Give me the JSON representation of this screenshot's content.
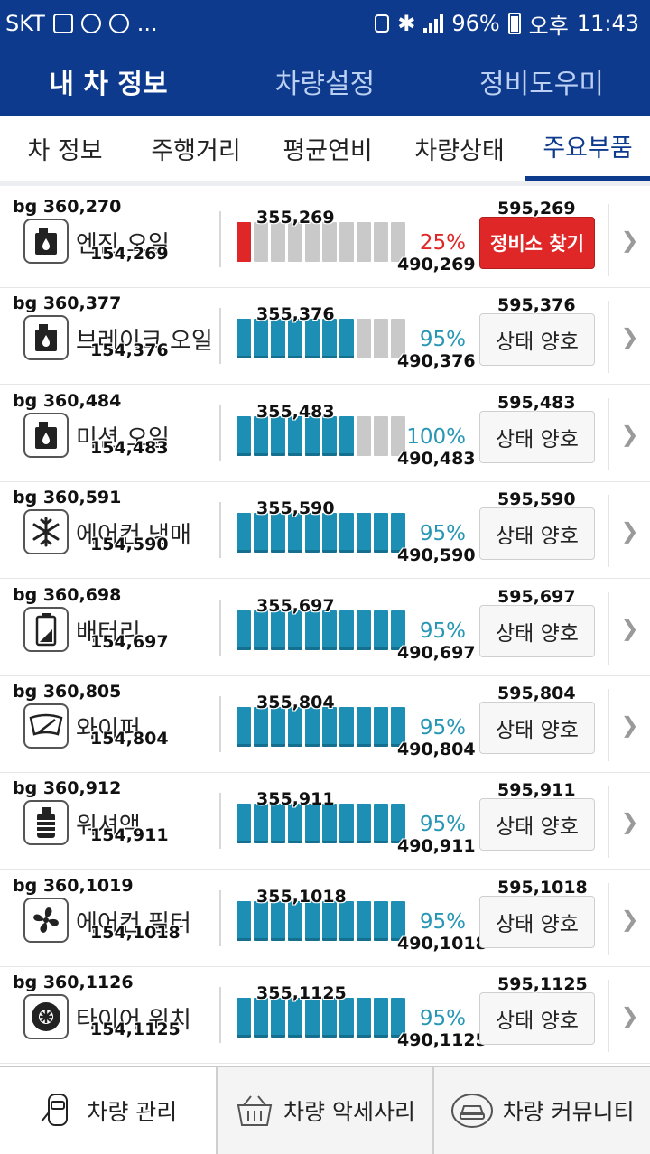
{
  "status_bar": {
    "carrier": "SKT",
    "more": "...",
    "battery": "96%",
    "ampm": "오후",
    "time": "11:43"
  },
  "app_tabs": [
    {
      "label": "내 차 정보",
      "active": true
    },
    {
      "label": "차량설정",
      "active": false
    },
    {
      "label": "정비도우미",
      "active": false
    }
  ],
  "sub_tabs": [
    {
      "label": "차 정보",
      "active": false
    },
    {
      "label": "주행거리",
      "active": false
    },
    {
      "label": "평균연비",
      "active": false
    },
    {
      "label": "차량상태",
      "active": false
    },
    {
      "label": "주요부품",
      "active": true
    }
  ],
  "parts": [
    {
      "bg": "bg 360,270",
      "name": "엔진 오일",
      "sub": "154,269",
      "icon": "oil-can-icon",
      "bar_top": "355,269",
      "level": 0.1,
      "bar_color": "#e02727",
      "percent": "25%",
      "bar_bottom": "490,269",
      "button_top": "595,269",
      "button": "정비소 찾기",
      "alert": true
    },
    {
      "bg": "bg 360,377",
      "name": "브레이크 오일",
      "sub": "154,376",
      "icon": "oil-can-icon",
      "bar_top": "355,376",
      "level": 0.7,
      "bar_color": "#1e8fb4",
      "percent": "95%",
      "bar_bottom": "490,376",
      "button_top": "595,376",
      "button": "상태 양호",
      "alert": false
    },
    {
      "bg": "bg 360,484",
      "name": "미션 오일",
      "sub": "154,483",
      "icon": "oil-can-icon",
      "bar_top": "355,483",
      "level": 0.7,
      "bar_color": "#1e8fb4",
      "percent": "100%",
      "bar_bottom": "490,483",
      "button_top": "595,483",
      "button": "상태 양호",
      "alert": false
    },
    {
      "bg": "bg 360,591",
      "name": "에어컨 냉매",
      "sub": "154,590",
      "icon": "snowflake-icon",
      "bar_top": "355,590",
      "level": 1.0,
      "bar_color": "#1e8fb4",
      "percent": "95%",
      "bar_bottom": "490,590",
      "button_top": "595,590",
      "button": "상태 양호",
      "alert": false
    },
    {
      "bg": "bg 360,698",
      "name": "배터리",
      "sub": "154,697",
      "icon": "battery-icon",
      "bar_top": "355,697",
      "level": 1.0,
      "bar_color": "#1e8fb4",
      "percent": "95%",
      "bar_bottom": "490,697",
      "button_top": "595,697",
      "button": "상태 양호",
      "alert": false
    },
    {
      "bg": "bg 360,805",
      "name": "와이퍼",
      "sub": "154,804",
      "icon": "wiper-icon",
      "bar_top": "355,804",
      "level": 1.0,
      "bar_color": "#1e8fb4",
      "percent": "95%",
      "bar_bottom": "490,804",
      "button_top": "595,804",
      "button": "상태 양호",
      "alert": false
    },
    {
      "bg": "bg 360,912",
      "name": "워셔액",
      "sub": "154,911",
      "icon": "washer-fluid-icon",
      "bar_top": "355,911",
      "level": 1.0,
      "bar_color": "#1e8fb4",
      "percent": "95%",
      "bar_bottom": "490,911",
      "button_top": "595,911",
      "button": "상태 양호",
      "alert": false
    },
    {
      "bg": "bg 360,1019",
      "name": "에어컨 필터",
      "sub": "154,1018",
      "icon": "fan-icon",
      "bar_top": "355,1018",
      "level": 1.0,
      "bar_color": "#1e8fb4",
      "percent": "95%",
      "bar_bottom": "490,1018",
      "button_top": "595,1018",
      "button": "상태 양호",
      "alert": false
    },
    {
      "bg": "bg 360,1126",
      "name": "타이어 위치",
      "sub": "154,1125",
      "icon": "tire-icon",
      "bar_top": "355,1125",
      "level": 1.0,
      "bar_color": "#1e8fb4",
      "percent": "95%",
      "bar_bottom": "490,1125",
      "button_top": "595,1125",
      "button": "상태 양호",
      "alert": false
    }
  ],
  "bottom_nav": [
    {
      "label": "차량 관리",
      "icon": "car-manage-icon"
    },
    {
      "label": "차량 악세사리",
      "icon": "basket-icon"
    },
    {
      "label": "차량 커뮤니티",
      "icon": "car-chat-icon"
    }
  ]
}
